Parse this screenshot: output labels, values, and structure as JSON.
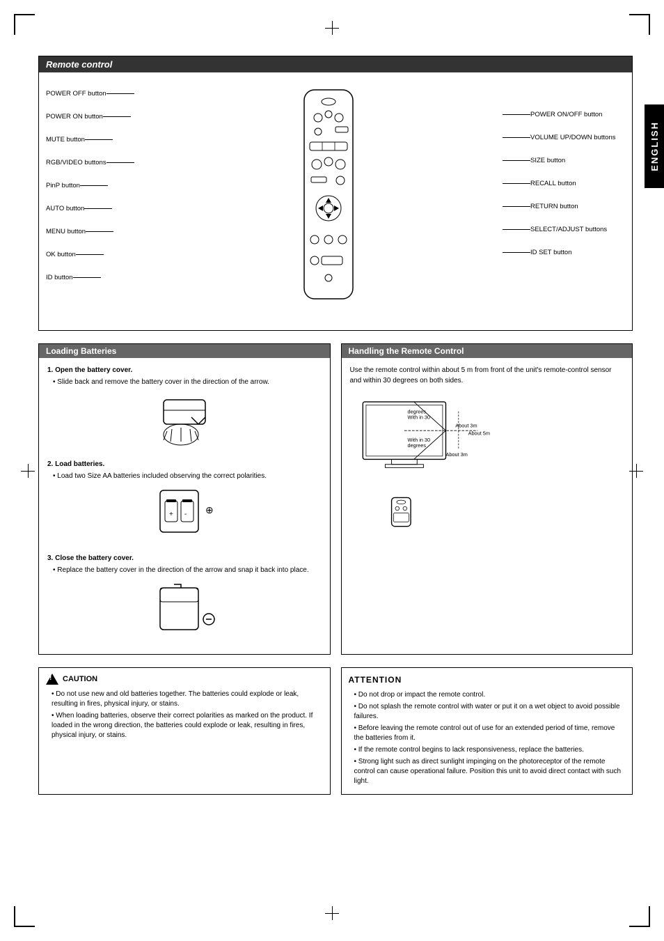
{
  "page": {
    "sidebar_label": "ENGLISH",
    "remote_control": {
      "section_title": "Remote control",
      "labels_left": [
        "POWER OFF button",
        "POWER ON button",
        "MUTE button",
        "RGB/VIDEO buttons",
        "PinP button",
        "AUTO button",
        "MENU button",
        "OK button",
        "ID button"
      ],
      "labels_right": [
        "POWER ON/OFF button",
        "VOLUME UP/DOWN buttons",
        "SIZE button",
        "RECALL button",
        "RETURN button",
        "SELECT/ADJUST buttons",
        "ID SET button"
      ]
    },
    "loading_batteries": {
      "section_title": "Loading Batteries",
      "step1_title": "1. Open the battery cover.",
      "step1_bullet": "Slide back and remove the battery cover in the direction of the arrow.",
      "step2_title": "2. Load batteries.",
      "step2_bullet": "Load two Size AA batteries included observing the correct polarities.",
      "step3_title": "3. Close the battery cover.",
      "step3_bullet": "Replace the battery cover in the direction of the arrow and snap it back into place."
    },
    "handling_remote": {
      "section_title": "Handling the Remote Control",
      "description": "Use the remote control within about 5 m from front of the unit's remote-control sensor and within 30 degrees on both sides.",
      "diagram_labels": [
        "With in 30 degrees",
        "With in 30 degrees",
        "About 3m",
        "About 3m",
        "About 5m"
      ]
    },
    "caution": {
      "title": "CAUTION",
      "bullets": [
        "Do not use new and old batteries together.  The batteries could explode or leak, resulting in fires, physical injury, or stains.",
        "When loading batteries, observe their correct polarities as marked on the product. If loaded in the wrong direction, the batteries could explode or leak, resulting in fires, physical injury, or stains."
      ]
    },
    "attention": {
      "title": "ATTENTION",
      "bullets": [
        "Do not drop or impact the remote control.",
        "Do not splash the remote control with water or put it on a wet object to avoid possible failures.",
        "Before leaving the remote control out of use for an extended period of time, remove the batteries from it.",
        "If the remote control begins to lack responsiveness, replace the batteries.",
        "Strong light such as direct sunlight impinging on the photoreceptor of the remote control can cause operational failure. Position this unit to avoid direct contact with such light."
      ]
    }
  }
}
